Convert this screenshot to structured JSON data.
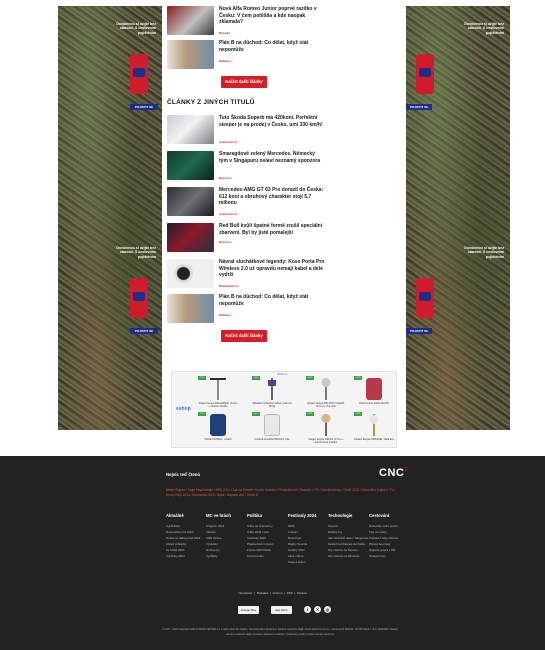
{
  "top_articles": [
    {
      "title": "Nová Alfa Romeo Junior poprvé razítko v Česku: V čem potěšila a kde naopak zklamala?",
      "category": "Motorky"
    },
    {
      "title": "Plán B na důchod: Co dělat, když stát nepomůže",
      "category": "Reklama"
    }
  ],
  "load_more_label": "Načíst další články",
  "section_title": "ČLÁNKY Z JINÝCH TITULŮ",
  "other_articles": [
    {
      "title": "Tuto Škoda Superb má 420koní. Perfektní sleeper je na prodej v Česku, umí 330 km/h!",
      "category": "Autoforum.cz"
    },
    {
      "title": "Smaragdově zelený Mercedes. Německý tým v Singapuru oslaví neznámý sponzora",
      "category": "Report.cz"
    },
    {
      "title": "Mercedes-AMG GT 63 Pro dorazil do Česka: 612 koní a obruhový charakter stojí 5,7 milionu",
      "category": "Autoforum.cz"
    },
    {
      "title": "Red Bull kvůli špatné formě zrušil speciální zbarvení. Byl by jistě pomalejší",
      "category": "Report.cz"
    },
    {
      "title": "Návrat sluchátkové legendy: Koss Porta Pro Wireless 2.0 už opravdu nemají kabel a délé vydrží",
      "category": "Mobilmania.cz"
    },
    {
      "title": "Plán B na důchod: Co dělat, když stát nepomůže",
      "category": "Reklama"
    }
  ],
  "load_more_label_2": "Načíst další články",
  "ad": {
    "label": "Reklama",
    "logo": "eshop",
    "products": [
      {
        "name": "Stojací lampa BALLEREN, chrom + vkusné stínítko",
        "tag": "-21%"
      },
      {
        "name": "Skládací zahradní nožka, nosnost 90 kg",
        "tag": "-18%"
      },
      {
        "name": "Stojací lampa BALDON CLEAR, chrom + čiré sklo",
        "tag": "-14%"
      },
      {
        "name": "Polstrované křeslo RAOS",
        "tag": "-32%"
      },
      {
        "name": "Křeslo NOVELL, modré",
        "tag": "-12%"
      },
      {
        "name": "Kožená lenoška PRETAS, bílá",
        "tag": "-11%"
      },
      {
        "name": "Stojací lampa GENIS, chrom + bambusové stínítko",
        "tag": "-13%"
      },
      {
        "name": "Sedací lampa CIBOANE, zlatá kov",
        "tag": "-15%"
      }
    ]
  },
  "skin": {
    "promo_text": "Dovolenou si užijte bez starostí. S cestovním pojištěním",
    "cta": "POJISTIT SE"
  },
  "footer": {
    "most_read": "Nejvíc teď čtená",
    "logo": "CNC",
    "hot_links": "Blesk Hlupáci / Moje Psychologie / NFB 2024 / Jak na Skvělé / Konec turistiky / Prostořekové / Resulta ∞ TV / Arkelaknizhky / OMG 2024 / Atmosféra krajky ∞ TV / Druhý FAQ 2024 / Bosňanka 2024 / Apka / Nápady dne / Deník B",
    "columns": [
      {
        "heading": "Aktuálně",
        "items": [
          "Cyklistická",
          "Doporučený trik 2024",
          "Dobrá na nákup před 2024",
          "Zdraví průkazky",
          "Ze hřiště 2024",
          "Cyklistky 2024"
        ]
      },
      {
        "heading": "MC ve hrách",
        "items": [
          "Program 2024",
          "Tabulky",
          "CNN Online",
          "Výsledky",
          "Rozhovory",
          "Vypůjčky"
        ]
      },
      {
        "heading": "Politika",
        "items": [
          "Volby do Sněmovny",
          "Volby 2024 v letu",
          "Cestovky 2024",
          "Předsednictví zprávy",
          "Policie 2024 Rada",
          "Změnit leden"
        ]
      },
      {
        "heading": "Festivaly 2024",
        "items": [
          "MMF",
          "Colours",
          "Rock Fest",
          "Mighty Sounds",
          "Hradby 2024",
          "Akce v Brně",
          "Snap a kolem"
        ]
      },
      {
        "heading": "Technologie",
        "items": [
          "OpenAI",
          "Mobilní hry",
          "Jak zachránit data v Telegramu",
          "Ideální bezdrátová sluchátka",
          "Hry zdarma na Steamu",
          "Hry zdarma na Windows"
        ]
      },
      {
        "heading": "Cestování",
        "items": [
          "Dokonalé vodní sporty",
          "Tipy na výlety",
          "Pražské hrady zdarma",
          "Wyspa Seychely",
          "Nejlepší jezera v ČR",
          "Nejlepší hory"
        ]
      }
    ],
    "links": [
      "Newsletter",
      "Redakce",
      "Inzerce",
      "RSS",
      "Kariéra"
    ],
    "google_play": "Google Play",
    "app_store": "App Store",
    "copyright": "© 2007 – 2024 Copyright CZECH NEWS CENTER a.s. a další autoři dle obsahu. Všechna práva vyhrazena. Správce osobních údajů: Czech News Center a.s., Komunardů 1584/42, 170 00 Praha 7, IČO: 02346826. Zásady ochrany osobních údajů | Cookies | Nastavení soukromí | Podmínky použití | Kodex ochrany soukromí"
  }
}
